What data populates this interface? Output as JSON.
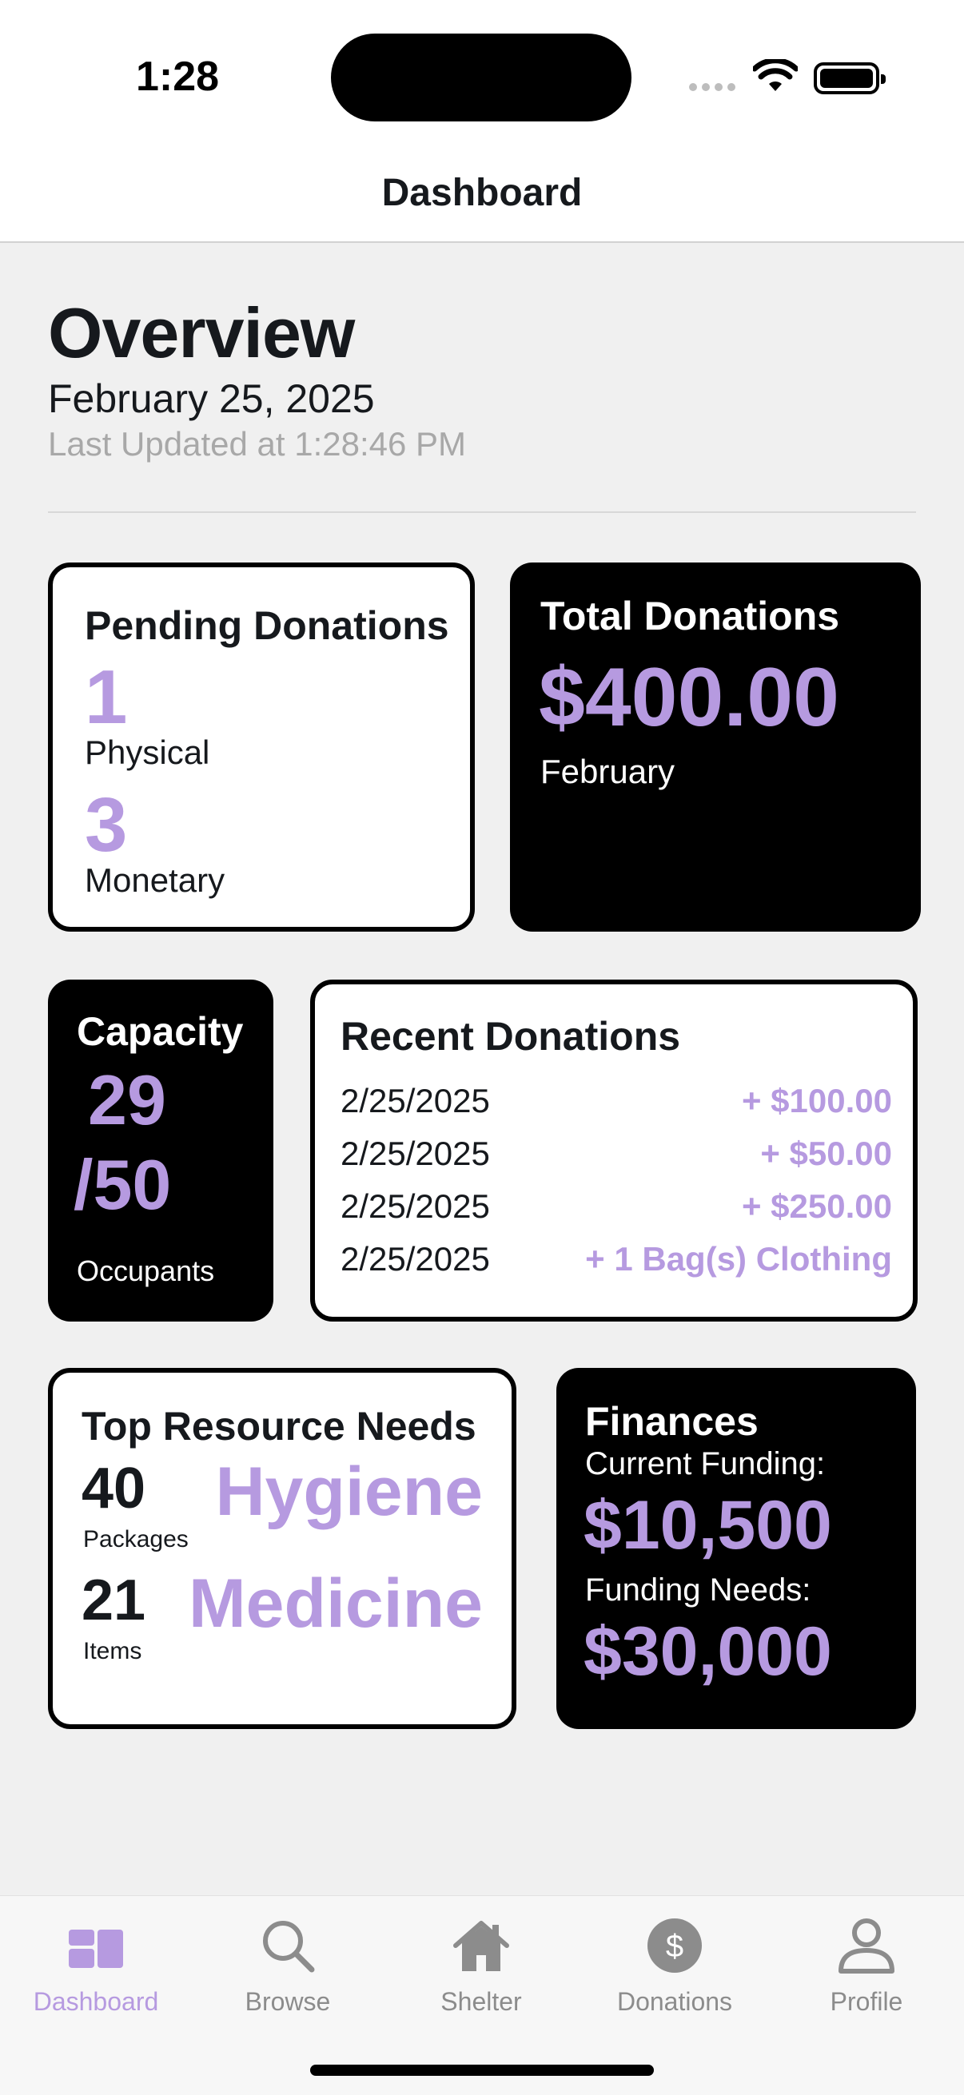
{
  "status": {
    "time": "1:28"
  },
  "header": {
    "title": "Dashboard"
  },
  "overview": {
    "title": "Overview",
    "date": "February 25, 2025",
    "last_updated": "Last Updated at 1:28:46 PM"
  },
  "pending": {
    "title": "Pending Donations",
    "physical_count": "1",
    "physical_label": "Physical",
    "monetary_count": "3",
    "monetary_label": "Monetary"
  },
  "total": {
    "title": "Total Donations",
    "amount": "$400.00",
    "period": "February"
  },
  "capacity": {
    "title": "Capacity",
    "current": "29",
    "max": "/50",
    "label": "Occupants"
  },
  "recent": {
    "title": "Recent Donations",
    "rows": [
      {
        "date": "2/25/2025",
        "amount": "+ $100.00"
      },
      {
        "date": "2/25/2025",
        "amount": "+ $50.00"
      },
      {
        "date": "2/25/2025",
        "amount": "+ $250.00"
      },
      {
        "date": "2/25/2025",
        "amount": "+ 1 Bag(s) Clothing"
      }
    ]
  },
  "needs": {
    "title": "Top Resource Needs",
    "items": [
      {
        "count": "40",
        "unit": "Packages",
        "name": "Hygiene"
      },
      {
        "count": "21",
        "unit": "Items",
        "name": "Medicine"
      }
    ]
  },
  "finances": {
    "title": "Finances",
    "current_label": "Current Funding:",
    "current_amount": "$10,500",
    "needs_label": "Funding Needs:",
    "needs_amount": "$30,000"
  },
  "tabs": [
    {
      "label": "Dashboard",
      "icon": "dashboard-icon",
      "active": true
    },
    {
      "label": "Browse",
      "icon": "search-icon",
      "active": false
    },
    {
      "label": "Shelter",
      "icon": "house-icon",
      "active": false
    },
    {
      "label": "Donations",
      "icon": "dollar-circle-icon",
      "active": false
    },
    {
      "label": "Profile",
      "icon": "person-icon",
      "active": false
    }
  ],
  "colors": {
    "accent": "#b69ae0",
    "dark_card": "#000000",
    "background": "#f0f0f0"
  }
}
